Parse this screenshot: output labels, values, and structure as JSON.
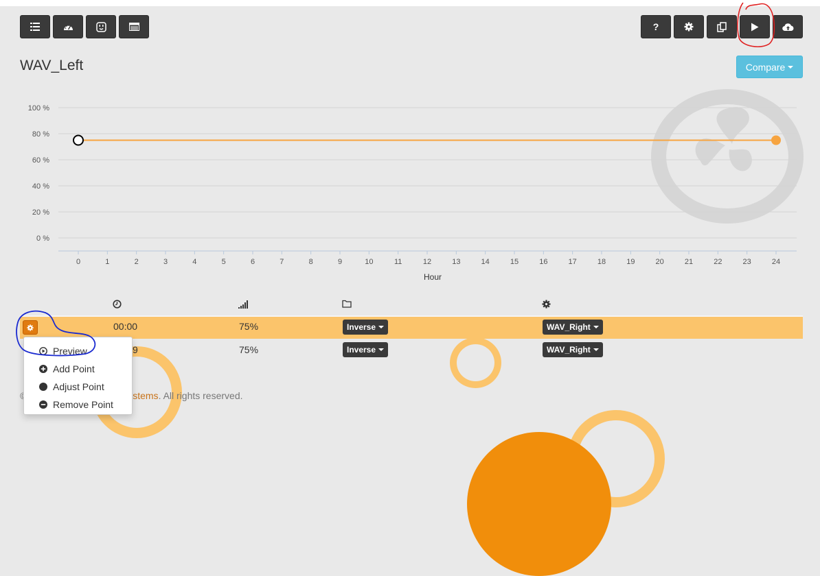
{
  "toolbar_left": [
    {
      "name": "list-icon"
    },
    {
      "name": "dashboard-icon"
    },
    {
      "name": "outlet-icon"
    },
    {
      "name": "table-icon"
    }
  ],
  "toolbar_right": [
    {
      "name": "help-icon",
      "label": "?"
    },
    {
      "name": "gear-icon"
    },
    {
      "name": "copy-icon"
    },
    {
      "name": "play-icon"
    },
    {
      "name": "cloud-upload-icon"
    }
  ],
  "page_title": "WAV_Left",
  "compare_label": "Compare",
  "chart_data": {
    "type": "line",
    "xlabel": "Hour",
    "x_ticks": [
      "0",
      "1",
      "2",
      "3",
      "4",
      "5",
      "6",
      "7",
      "8",
      "9",
      "10",
      "11",
      "12",
      "13",
      "14",
      "15",
      "16",
      "17",
      "18",
      "19",
      "20",
      "21",
      "22",
      "23",
      "24"
    ],
    "y_ticks": [
      "100 %",
      "80 %",
      "60 %",
      "40 %",
      "20 %",
      "0 %"
    ],
    "ylim": [
      0,
      100
    ],
    "xlim": [
      0,
      24
    ],
    "series": [
      {
        "points": [
          [
            0,
            75
          ],
          [
            24,
            75
          ]
        ],
        "color": "#f7a440"
      }
    ]
  },
  "table": {
    "columns": [
      {
        "icon": "clock-icon"
      },
      {
        "icon": "signal-icon"
      },
      {
        "icon": "folder-icon"
      },
      {
        "icon": "gear-icon"
      }
    ],
    "rows": [
      {
        "time": "00:00",
        "level": "75%",
        "mode": "Inverse",
        "target": "WAV_Right",
        "active": true
      },
      {
        "time": "9",
        "level": "75%",
        "mode": "Inverse",
        "target": "WAV_Right",
        "active": false
      }
    ]
  },
  "menu": {
    "items": [
      {
        "label": "Preview",
        "icon": "play-circle-icon"
      },
      {
        "label": "Add Point",
        "icon": "plus-circle-icon"
      },
      {
        "label": "Adjust Point",
        "icon": "circle-icon"
      },
      {
        "label": "Remove Point",
        "icon": "minus-circle-icon"
      }
    ]
  },
  "footer": {
    "prefix": "©",
    "brand": "ystems",
    "suffix": ". All rights reserved."
  },
  "colors": {
    "accent_orange": "#f7a440",
    "highlight_row": "#fbc46b",
    "compare_blue": "#5bc0de",
    "dark_button": "#3a3a3a"
  }
}
